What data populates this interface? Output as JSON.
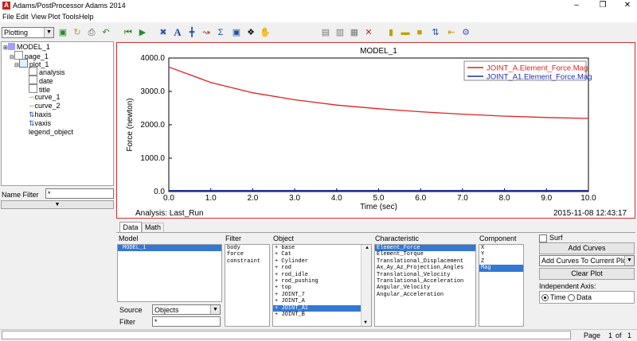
{
  "window": {
    "title": "Adams/PostProcessor Adams 2014",
    "app_icon": "A"
  },
  "menu": [
    "File",
    "Edit",
    "View",
    "Plot",
    "Tools",
    "Help"
  ],
  "toolbar": {
    "mode_select": "Plotting"
  },
  "tree": {
    "model": "MODEL_1",
    "page": "page_1",
    "plot": "plot_1",
    "children": [
      "analysis",
      "date",
      "title",
      "curve_1",
      "curve_2",
      "haxis",
      "vaxis"
    ],
    "legend": "legend_object"
  },
  "name_filter": {
    "label": "Name Filter",
    "value": "*"
  },
  "plot": {
    "title": "MODEL_1",
    "ylabel": "Force (newton)",
    "xlabel": "Time (sec)",
    "analysis": "Analysis:  Last_Run",
    "timestamp": "2015-11-08 12:43:17",
    "legend": [
      "JOINT_A.Element_Force.Mag",
      "JOINT_A1.Element_Force.Mag"
    ],
    "colors": {
      "curve_1": "#e41e1e",
      "curve_2": "#1e2ea8",
      "border": "#d03232"
    }
  },
  "chart_data": {
    "type": "line",
    "title": "MODEL_1",
    "xlabel": "Time (sec)",
    "ylabel": "Force (newton)",
    "xlim": [
      0,
      10
    ],
    "ylim": [
      0,
      4000
    ],
    "xticks": [
      "0.0",
      "1.0",
      "2.0",
      "3.0",
      "4.0",
      "5.0",
      "6.0",
      "7.0",
      "8.0",
      "9.0",
      "10.0"
    ],
    "yticks": [
      "0.0",
      "1000.0",
      "2000.0",
      "3000.0",
      "4000.0"
    ],
    "x": [
      0,
      1,
      2,
      3,
      4,
      5,
      6,
      7,
      8,
      9,
      10
    ],
    "series": [
      {
        "name": "JOINT_A.Element_Force.Mag",
        "values": [
          3730,
          3270,
          2960,
          2750,
          2590,
          2480,
          2390,
          2320,
          2260,
          2220,
          2190
        ]
      },
      {
        "name": "JOINT_A1.Element_Force.Mag",
        "values": [
          30,
          30,
          30,
          30,
          30,
          30,
          30,
          30,
          30,
          30,
          30
        ]
      }
    ],
    "grid": false,
    "legend_position": "top-right"
  },
  "tabs": [
    "Data",
    "Math"
  ],
  "browser": {
    "model_header": "Model",
    "filter_header": "Filter",
    "object_header": "Object",
    "char_header": "Characteristic",
    "comp_header": "Component",
    "models": [
      "MODEL_1"
    ],
    "filters": [
      "body",
      "force",
      "constraint"
    ],
    "objects": [
      "+ base",
      "+ Cat",
      "+ Cylinder",
      "+ rod",
      "+ rod_idle",
      "+ rod_pushing",
      "+ top",
      "+ JOINT_7",
      "+ JOINT_A",
      "+ JOINT_A1",
      "+ JOINT_B"
    ],
    "characteristics": [
      "Element_Force",
      "Element_Torque",
      "Translational_Displacement",
      "Ax_Ay_Az_Projection_Angles",
      "Translational_Velocity",
      "Translational_Acceleration",
      "Angular_Velocity",
      "Angular_Acceleration"
    ],
    "components": [
      "X",
      "Y",
      "Z",
      "Mag"
    ],
    "source_label": "Source",
    "source_value": "Objects",
    "filter_label": "Filter",
    "filter_value": "*"
  },
  "actions": {
    "surf": "Surf",
    "add_curves": "Add Curves",
    "add_mode": "Add Curves To Current Plot",
    "clear_plot": "Clear Plot",
    "indep_axis": "Independent Axis:",
    "time": "Time",
    "data": "Data"
  },
  "status": {
    "page_label": "Page",
    "page_num": "1",
    "of": "of",
    "page_total": "1"
  }
}
